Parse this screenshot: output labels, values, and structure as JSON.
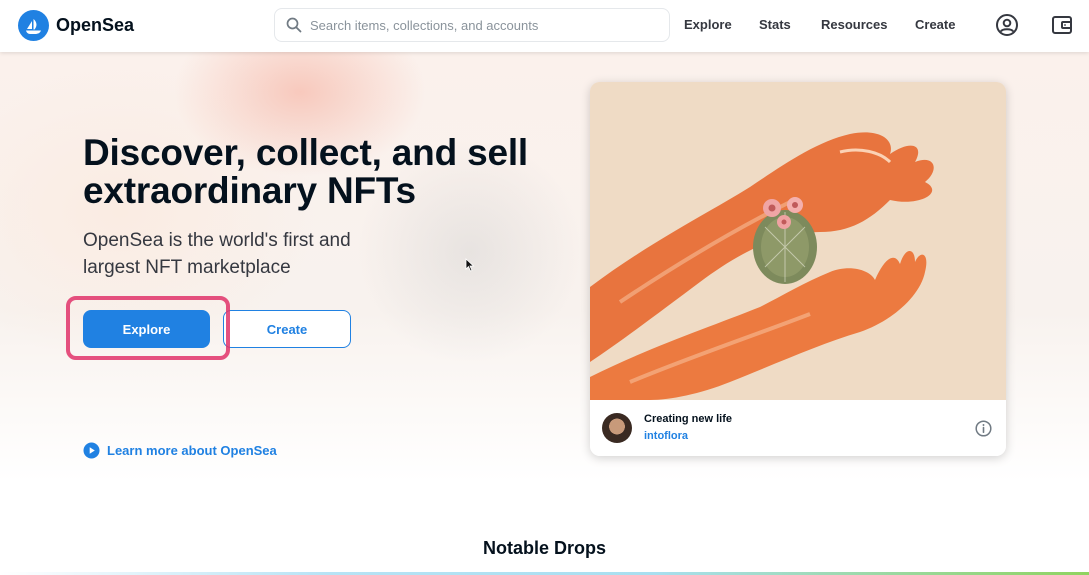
{
  "header": {
    "brand": "OpenSea",
    "search_placeholder": "Search items, collections, and accounts",
    "nav": [
      "Explore",
      "Stats",
      "Resources",
      "Create"
    ],
    "icons": [
      "profile-icon",
      "wallet-icon"
    ]
  },
  "hero": {
    "title": "Discover, collect, and sell extraordinary NFTs",
    "subtitle": "OpenSea is the world's first and largest NFT marketplace",
    "explore_label": "Explore",
    "create_label": "Create",
    "learn_label": "Learn more about OpenSea"
  },
  "featured": {
    "title": "Creating new life",
    "author": "intoflora"
  },
  "section": {
    "notable_title": "Notable Drops"
  },
  "colors": {
    "accent": "#2081e2",
    "highlight": "#e0336a",
    "text": "#04111d"
  }
}
